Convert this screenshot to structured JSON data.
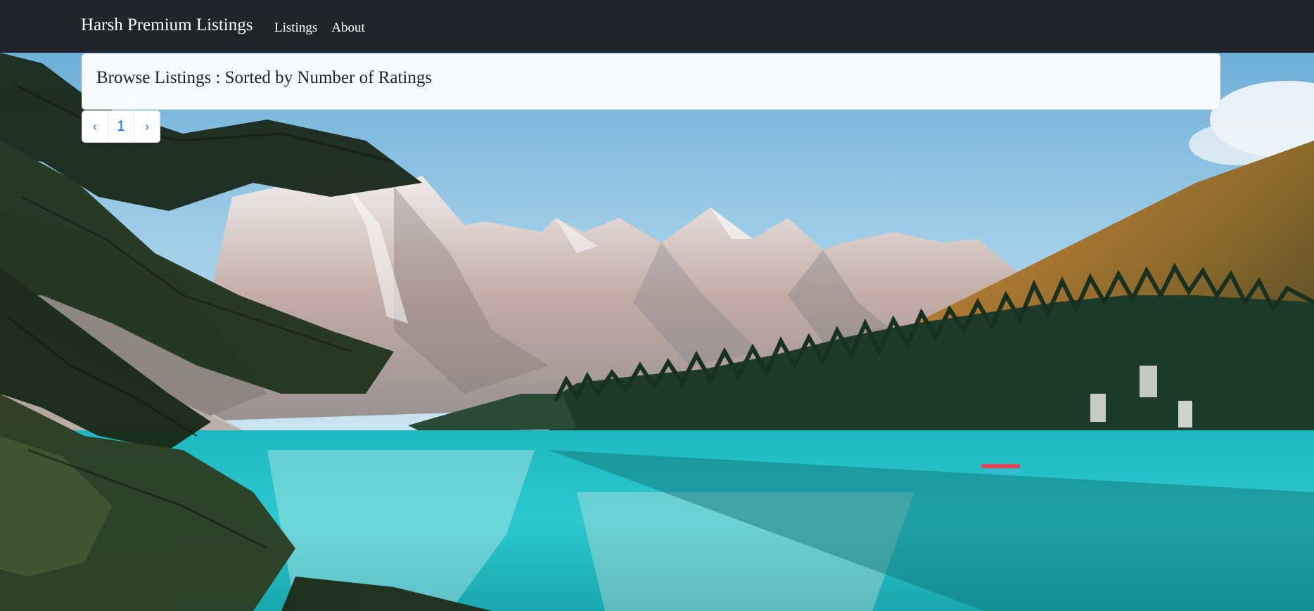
{
  "navbar": {
    "brand": "Harsh Premium Listings",
    "links": [
      {
        "label": "Listings"
      },
      {
        "label": "About"
      }
    ],
    "background_color": "#212529"
  },
  "header": {
    "title": "Browse Listings : Sorted by Number of Ratings"
  },
  "pagination": {
    "prev_label": "‹",
    "pages": [
      "1"
    ],
    "next_label": "›",
    "link_color": "#0d6efd"
  }
}
